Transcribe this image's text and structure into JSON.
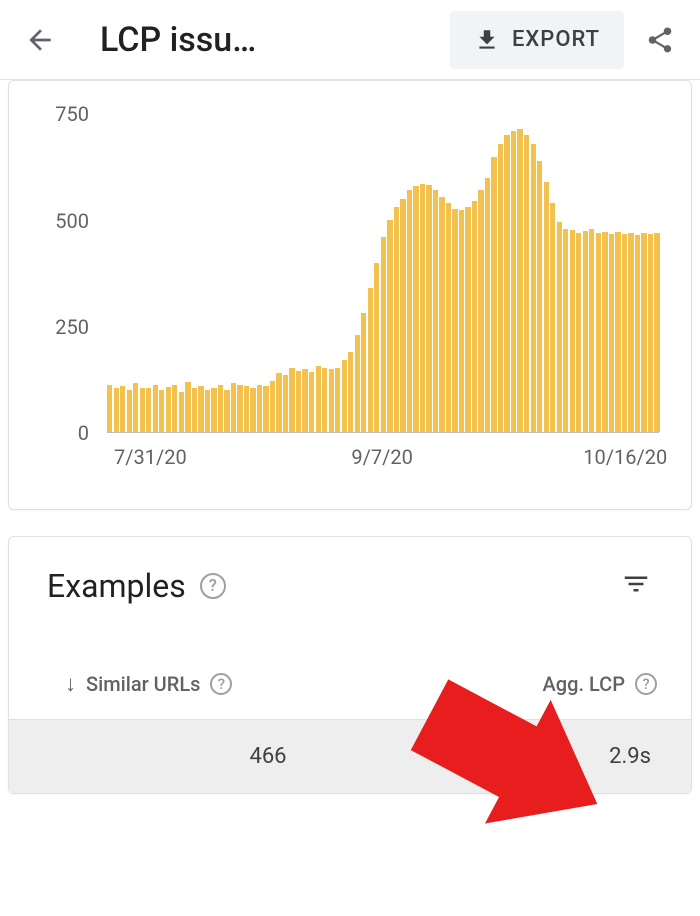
{
  "header": {
    "title": "LCP issu…",
    "export_label": "EXPORT"
  },
  "chart_data": {
    "type": "bar",
    "title": "",
    "xlabel": "",
    "ylabel": "",
    "ylim": [
      0,
      800
    ],
    "y_ticks": [
      0,
      250,
      500,
      750
    ],
    "x_ticks": [
      {
        "label": "7/31/20",
        "pos": 0.02
      },
      {
        "label": "9/7/20",
        "pos": 0.45
      },
      {
        "label": "10/16/20",
        "pos": 0.87
      }
    ],
    "values": [
      110,
      105,
      108,
      100,
      115,
      105,
      103,
      112,
      100,
      106,
      110,
      95,
      118,
      105,
      108,
      100,
      104,
      112,
      100,
      115,
      110,
      108,
      104,
      110,
      108,
      120,
      140,
      135,
      150,
      145,
      148,
      142,
      155,
      150,
      148,
      150,
      170,
      190,
      230,
      280,
      340,
      400,
      460,
      500,
      530,
      550,
      570,
      580,
      585,
      582,
      570,
      555,
      540,
      526,
      525,
      530,
      545,
      570,
      600,
      650,
      680,
      700,
      710,
      715,
      700,
      680,
      640,
      590,
      540,
      495,
      478,
      476,
      470,
      475,
      478,
      470,
      472,
      468,
      472,
      468,
      470,
      466,
      470,
      468,
      470
    ]
  },
  "examples": {
    "title": "Examples",
    "columns": {
      "similar_urls": "Similar URLs",
      "agg_lcp": "Agg. LCP"
    },
    "row": {
      "similar_urls_count": "466",
      "agg_lcp_value": "2.9s"
    }
  }
}
